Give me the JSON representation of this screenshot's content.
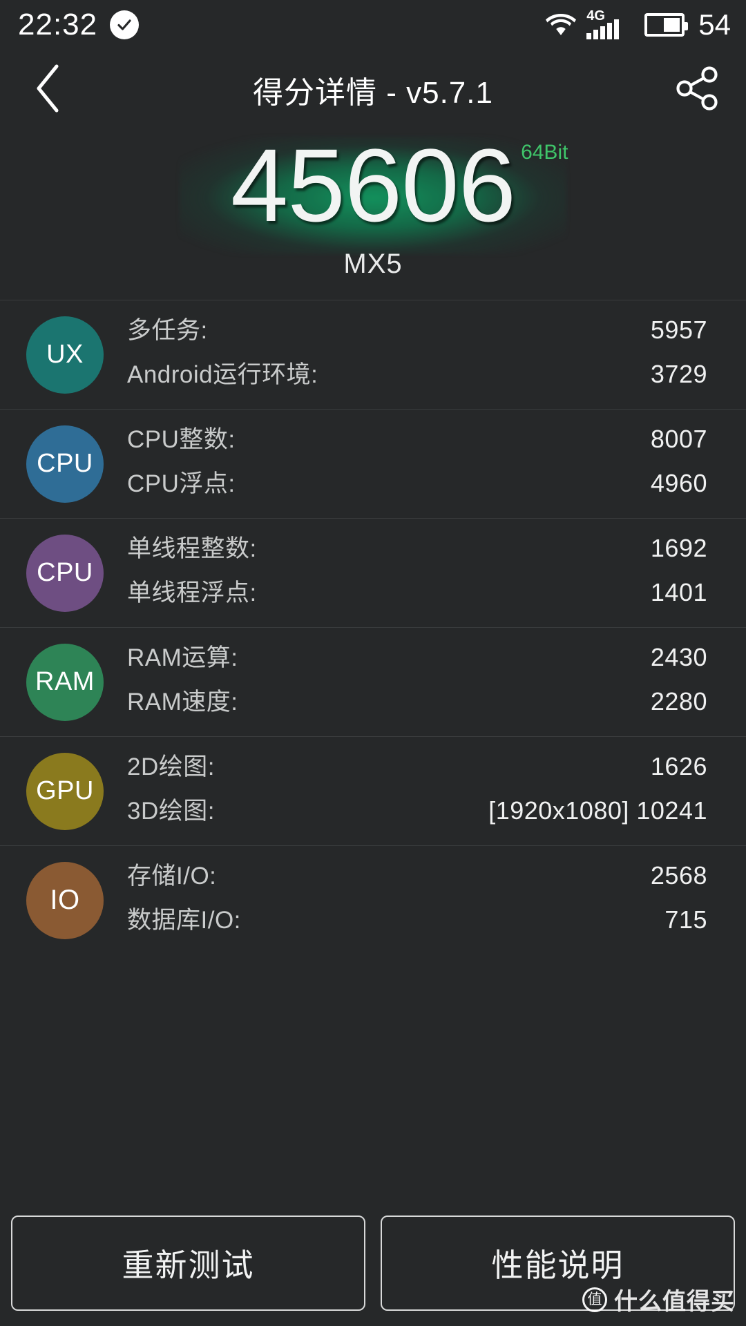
{
  "status_bar": {
    "clock": "22:32",
    "check_icon": "check-circle-icon",
    "wifi_icon": "wifi-icon",
    "network_label": "4G",
    "signal_icon": "cellular-signal-icon",
    "battery_icon": "battery-icon",
    "battery_percent": "54"
  },
  "title_bar": {
    "back_icon": "back-chevron-icon",
    "title": "得分详情 - v5.7.1",
    "share_icon": "share-icon"
  },
  "hero": {
    "score": "45606",
    "bit_badge": "64Bit",
    "device_model": "MX5",
    "glow_color": "#12965f",
    "bit_color": "#3fc56a"
  },
  "groups": [
    {
      "badge": "UX",
      "badge_color": "#1b7570",
      "metrics": [
        {
          "label": "多任务:",
          "value": "5957"
        },
        {
          "label": "Android运行环境:",
          "value": "3729"
        }
      ]
    },
    {
      "badge": "CPU",
      "badge_color": "#2f6d96",
      "metrics": [
        {
          "label": "CPU整数:",
          "value": "8007"
        },
        {
          "label": "CPU浮点:",
          "value": "4960"
        }
      ]
    },
    {
      "badge": "CPU",
      "badge_color": "#6e4e82",
      "metrics": [
        {
          "label": "单线程整数:",
          "value": "1692"
        },
        {
          "label": "单线程浮点:",
          "value": "1401"
        }
      ]
    },
    {
      "badge": "RAM",
      "badge_color": "#2e8456",
      "metrics": [
        {
          "label": "RAM运算:",
          "value": "2430"
        },
        {
          "label": "RAM速度:",
          "value": "2280"
        }
      ]
    },
    {
      "badge": "GPU",
      "badge_color": "#8a7a1e",
      "metrics": [
        {
          "label": "2D绘图:",
          "value": "1626"
        },
        {
          "label": "3D绘图:",
          "value": "[1920x1080] 10241"
        }
      ]
    },
    {
      "badge": "IO",
      "badge_color": "#8a5a33",
      "metrics": [
        {
          "label": "存储I/O:",
          "value": "2568"
        },
        {
          "label": "数据库I/O:",
          "value": "715"
        }
      ]
    }
  ],
  "footer": {
    "retest_label": "重新测试",
    "explain_label": "性能说明",
    "watermark_mark": "值",
    "watermark_text": "什么值得买"
  }
}
